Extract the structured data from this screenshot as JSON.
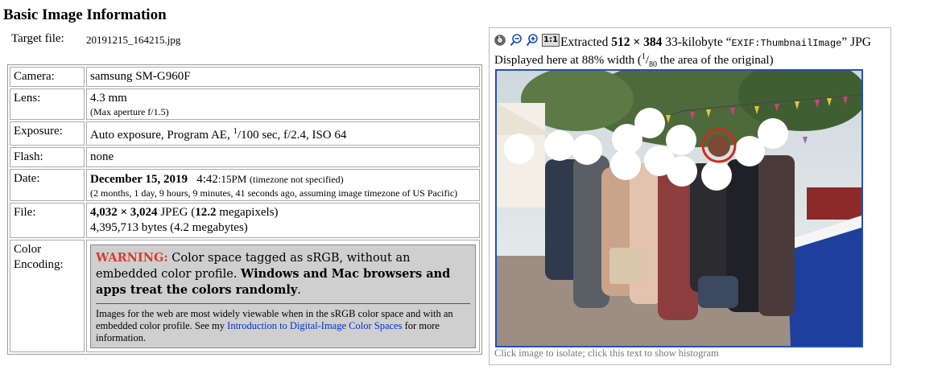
{
  "heading": "Basic Image Information",
  "target_file": {
    "label": "Target file:",
    "value": "20191215_164215.jpg"
  },
  "rows": {
    "camera": {
      "label": "Camera:",
      "value": "samsung SM-G960F"
    },
    "lens": {
      "label": "Lens:",
      "value": "4.3 mm",
      "note": "(Max aperture f/1.5)"
    },
    "exposure": {
      "label": "Exposure:",
      "pre": "Auto exposure, Program AE, ",
      "num": "1",
      "rest": "/100 sec, f/2.4, ISO 64"
    },
    "flash": {
      "label": "Flash:",
      "value": "none"
    },
    "date": {
      "label": "Date:",
      "date_bold": "December 15, 2019",
      "time": "4:42",
      "time_small": ":15PM",
      "tz": "(timezone not specified)",
      "ago": "(2 months, 1 day, 9 hours, 9 minutes, 41 seconds ago, assuming image timezone of US Pacific)"
    },
    "file": {
      "label": "File:",
      "dims": "4,032 × 3,024",
      "fmt": " JPEG (",
      "mp": "12.2",
      "mp_suffix": " megapixels)",
      "bytes": "4,395,713 bytes (4.2 megabytes)"
    },
    "color": {
      "label": "Color Encoding:",
      "warn_word": "WARNING:",
      "warn_text": " Color space tagged as sRGB, without an embedded color profile. ",
      "warn_bold": "Windows and Mac browsers and apps treat the colors randomly",
      "warn_end": ".",
      "note_pre": "Images for the web are most widely viewable when in the sRGB color space and with an embedded color profile. See my ",
      "note_link": "Introduction to Digital-Image Color Spaces",
      "note_post": " for more information."
    }
  },
  "thumbnail": {
    "extracted_pre": "Extracted ",
    "extracted_dims": "512 × 384",
    "extracted_mid": " 33-kilobyte “",
    "extracted_tag": "EXIF:ThumbnailImage",
    "extracted_post": "” JPG",
    "displayed_pre": "Displayed here at 88% width (",
    "frac_num": "1",
    "frac_den": "80",
    "displayed_post": " the area of the original)",
    "caption": "Click image to isolate; click this text to show histogram",
    "toolbar_icons": [
      "rotate-icon",
      "zoom-out-icon",
      "zoom-in-icon",
      "actual-size-icon"
    ],
    "actual_size_label": "1:1",
    "colors": {
      "frame": "#2251b8",
      "highlight": "#d22a1a"
    }
  }
}
